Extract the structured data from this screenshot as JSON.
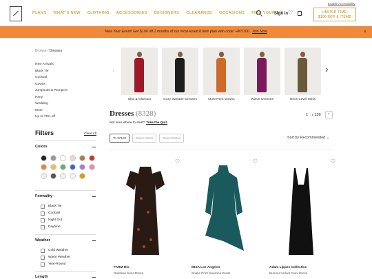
{
  "header": {
    "nav": [
      "PLANS",
      "WHAT'S NEW",
      "CLOTHING",
      "ACCESSORIES",
      "DESIGNERS",
      "CLEARANCE",
      "OCCASIONS",
      "FIND YOUR FIT"
    ],
    "access_link": "Enable Accessibility",
    "sign_in": "Sign in",
    "limited_line1": "LIMITED TIME:",
    "limited_line2": "$100 OFF 8 ITEMS"
  },
  "banner": {
    "text": "New Year Event! Get $100 off 2 months of our most-loved 8 item plan with code: HNY100",
    "cta": "Join Now",
    "close": "×"
  },
  "sidebar": {
    "crumb_root": "Browse",
    "crumb_sep": "/",
    "crumb_current": "Dresses",
    "links": [
      "New Arrivals",
      "Black Tie",
      "Cocktail",
      "Gowns",
      "Jumpsuits & Rompers",
      "Party",
      "Wedding",
      "More",
      "Up to 75% off"
    ],
    "filters_title": "Filters",
    "clear_all": "Clear All",
    "colors_title": "Colors",
    "formality_title": "Formality",
    "formality": [
      "Black Tie",
      "Cocktail",
      "Night Out",
      "Daytime"
    ],
    "weather_title": "Weather",
    "weather": [
      "Cold Weather",
      "Warm Weather",
      "Year-Round"
    ],
    "length_title": "Length"
  },
  "colors": [
    "#222222",
    "#999999",
    "#ffffff",
    "#e8dcc8",
    "#a57c52",
    "#c0392b",
    "#e8823a",
    "#e8c547",
    "#6aaa7a",
    "#3d63c9",
    "#a67bd3",
    "#e68bb5",
    "#eeeeee",
    "#555555",
    "#f5f0e6",
    "#f4f4f4",
    "#d4a017"
  ],
  "carousel": [
    {
      "label": "Glitz & Glamour",
      "color": "#9c1a2a"
    },
    {
      "label": "Cozy Sweater Dresses",
      "color": "#1d1d1d"
    },
    {
      "label": "Must-Rent Gowns",
      "color": "#d06a2a"
    },
    {
      "label": "Winter Dresses",
      "color": "#7a1a5a"
    },
    {
      "label": "Neon-Level Minis",
      "color": "#6b5a3a"
    }
  ],
  "main": {
    "title": "Dresses",
    "count": "(8328)",
    "page_current": "1",
    "page_total": "/ 139",
    "not_sure": "Not sure where to start?",
    "quiz": "Take the Quiz",
    "buttons": [
      "To 37129",
      "Select Sizes",
      "Select Dates"
    ],
    "sort": "Sort by Recommended"
  },
  "products": [
    {
      "brand": "FARM Rio",
      "name": "Rainbow Suns Dress",
      "color": "#2a1a14"
    },
    {
      "brand": "MISA Los Angeles",
      "name": "Snake Print Savanna Dress",
      "color": "#1a5a5c"
    },
    {
      "brand": "Adam Lippes Collective",
      "name": "Burnout Velvet Cami Dress",
      "color": "#111111"
    }
  ]
}
